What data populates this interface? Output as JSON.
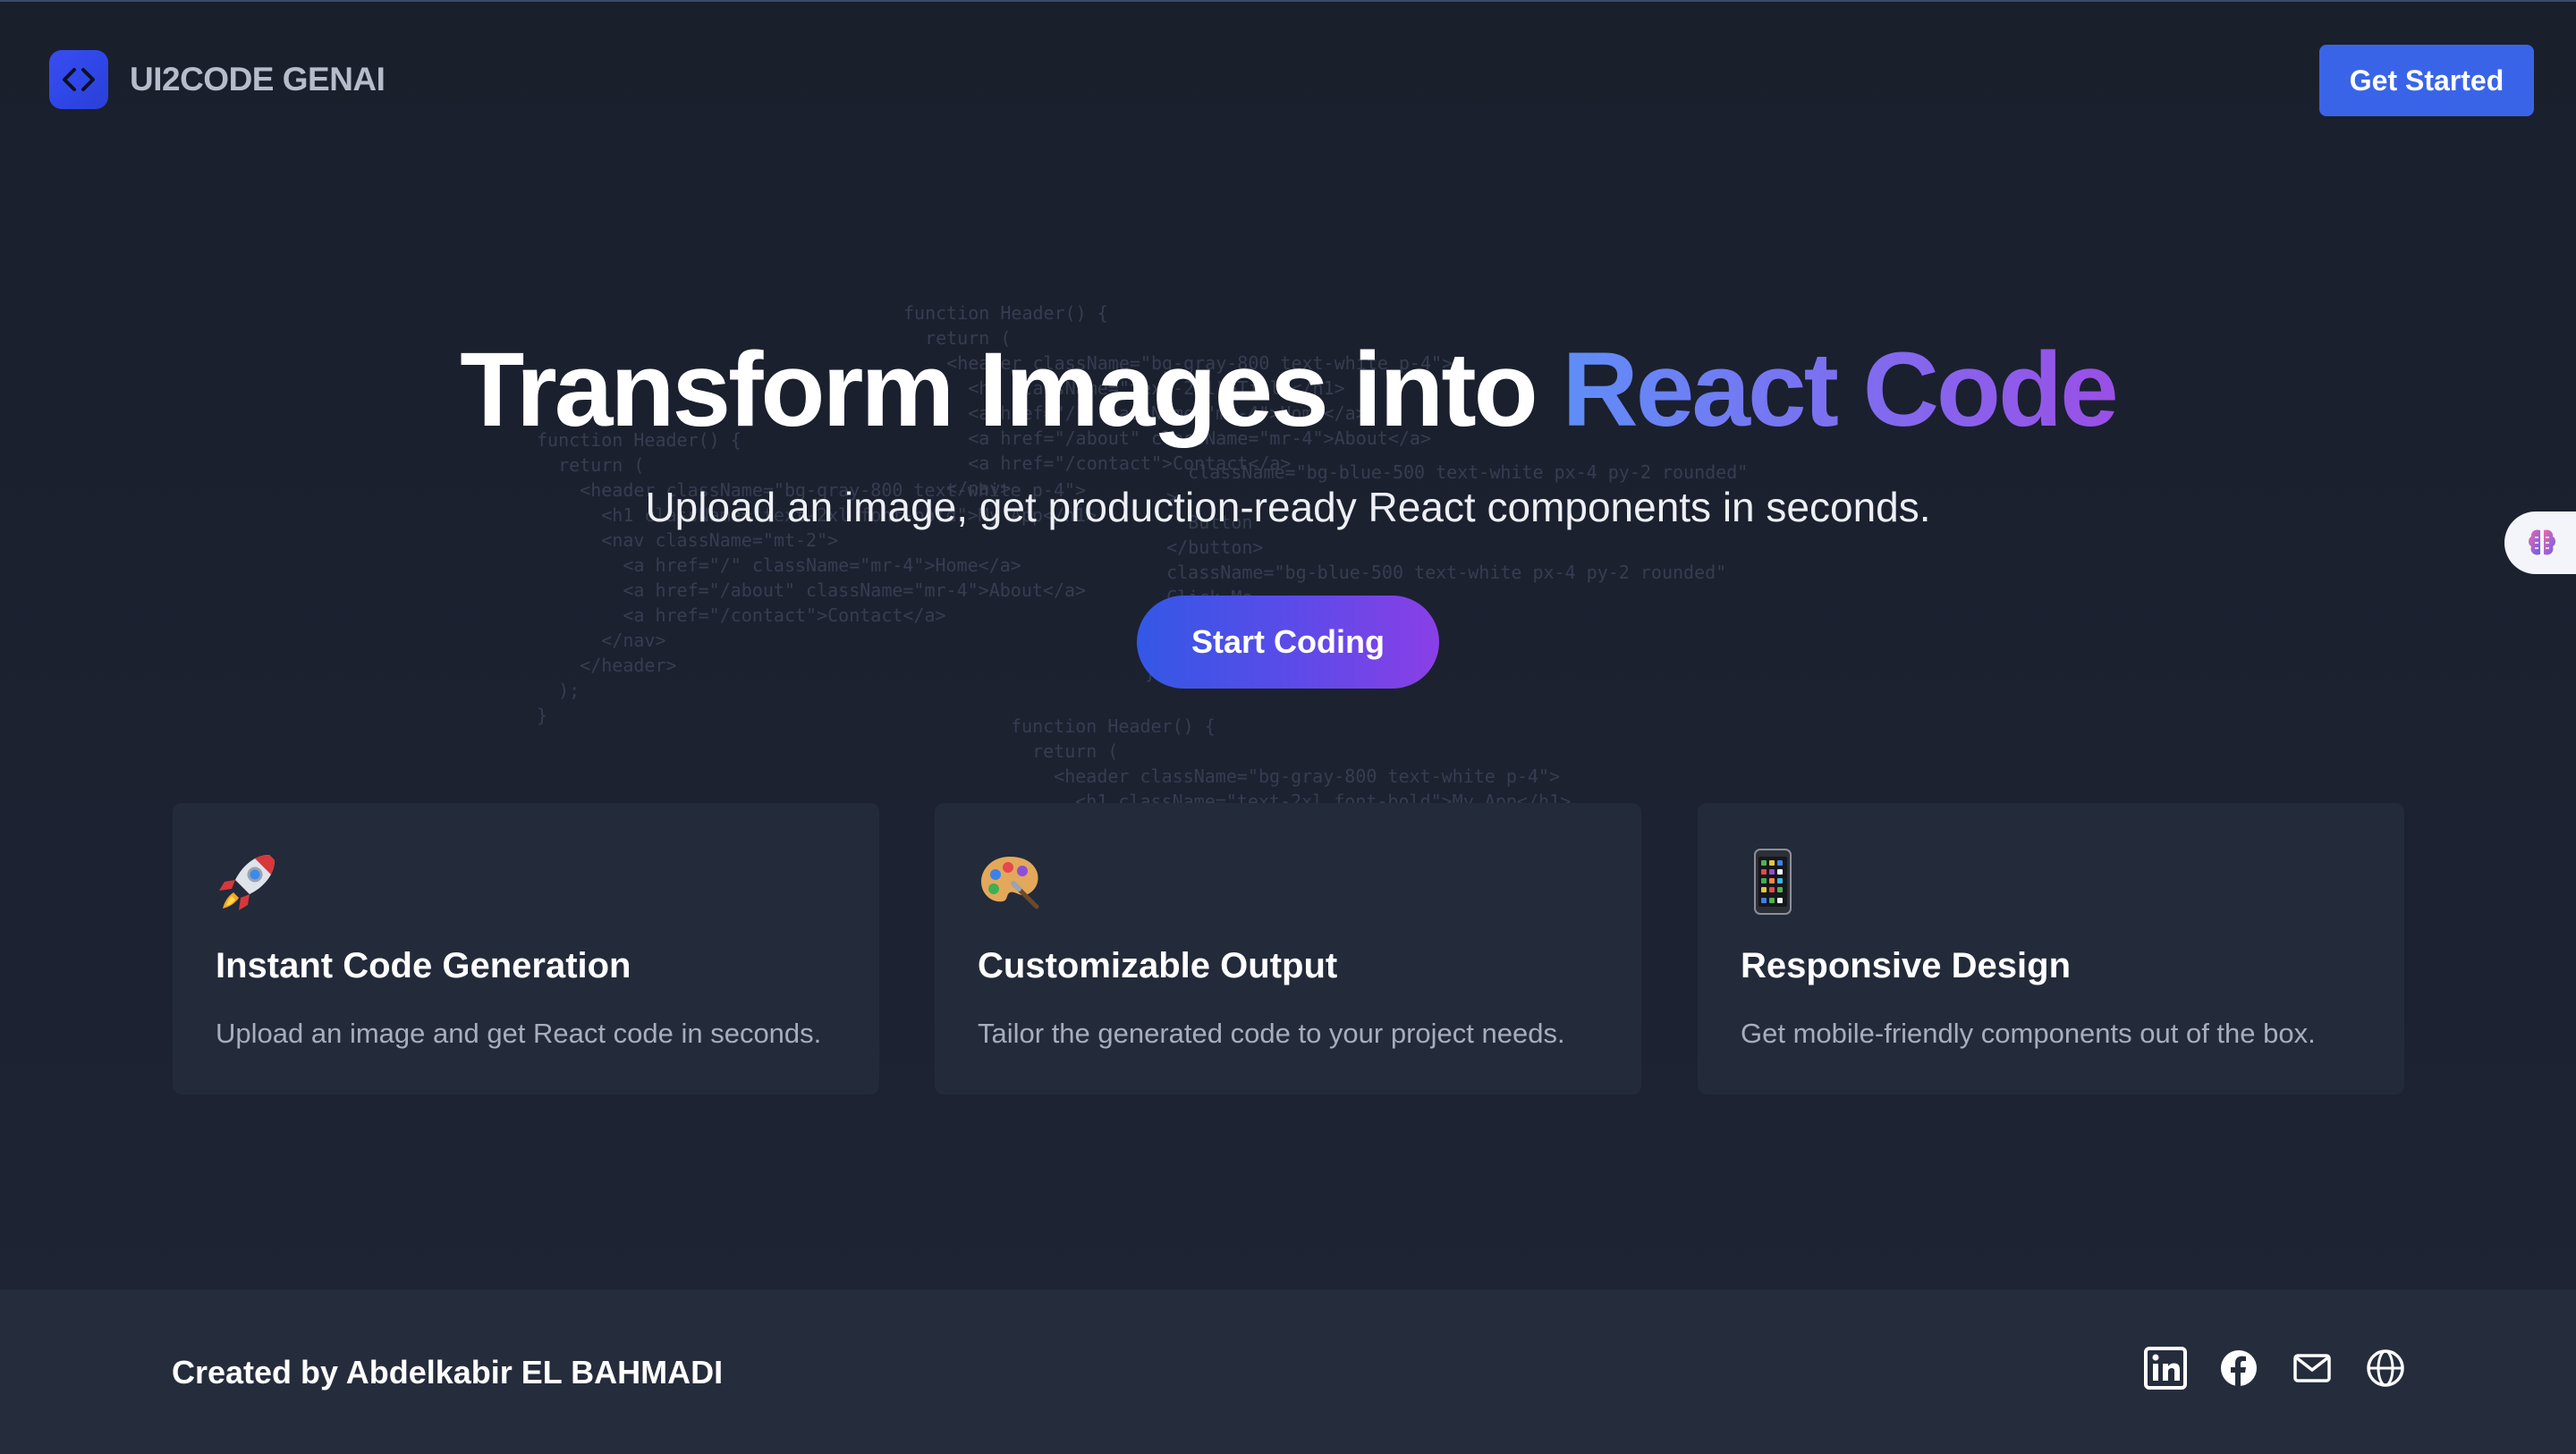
{
  "header": {
    "brand": "UI2CODE GENAI",
    "get_started_label": "Get Started"
  },
  "hero": {
    "title_plain": "Transform Images into ",
    "title_highlight": "React Code",
    "subtitle": "Upload an image, get production-ready React components in seconds.",
    "cta_label": "Start Coding"
  },
  "features": [
    {
      "icon": "rocket-icon",
      "title": "Instant Code Generation",
      "description": "Upload an image and get React code in seconds."
    },
    {
      "icon": "palette-icon",
      "title": "Customizable Output",
      "description": "Tailor the generated code to your project needs."
    },
    {
      "icon": "mobile-phone-icon",
      "title": "Responsive Design",
      "description": "Get mobile-friendly components out of the box."
    }
  ],
  "footer": {
    "credit": "Created by Abdelkabir EL BAHMADI",
    "social_icons": [
      "linkedin-icon",
      "facebook-icon",
      "mail-icon",
      "globe-icon"
    ]
  },
  "code_background": {
    "block_a": "function Header() {\n  return (\n    <header className=\"bg-gray-800 text-white p-4\">\n      <h1 className=\"text-2xl font-bold\">My App</h1>\n      <nav className=\"mt-2\">\n        <a href=\"/\" className=\"mr-4\">Home</a>\n        <a href=\"/about\" className=\"mr-4\">About</a>\n        <a href=\"/contact\">Contact</a>\n      </nav>\n    </header>\n  );\n}",
    "block_b": "function Header() {\n  return (\n    <header className=\"bg-gray-800 text-white p-4\">\n      <h1 className=\"text-2xl\">Title</h1>\n      <a href=\"/\" className=\"mr-4\">Home</a>\n      <a href=\"/about\" className=\"mr-4\">About</a>\n      <a href=\"/contact\">Contact</a>\n    </nav>\n  );",
    "block_c": "    className=\"bg-blue-500 text-white px-4 py-2 rounded\"\n  >\n    Button\n  </button>\n  className=\"bg-blue-500 text-white px-4 py-2 rounded\"\n  Click Me\n  </button>\n  );\n}",
    "block_d": "function Header() {\n  return (\n    <header className=\"bg-gray-800 text-white p-4\">\n      <h1 className=\"text-2xl font-bold\">My App</h1>"
  },
  "colors": {
    "accent_blue": "#3a64e8",
    "gradient_start": "#5f8ef7",
    "gradient_end": "#9a4fe6",
    "background": "#1b2130",
    "card_background": "#232a3a"
  }
}
